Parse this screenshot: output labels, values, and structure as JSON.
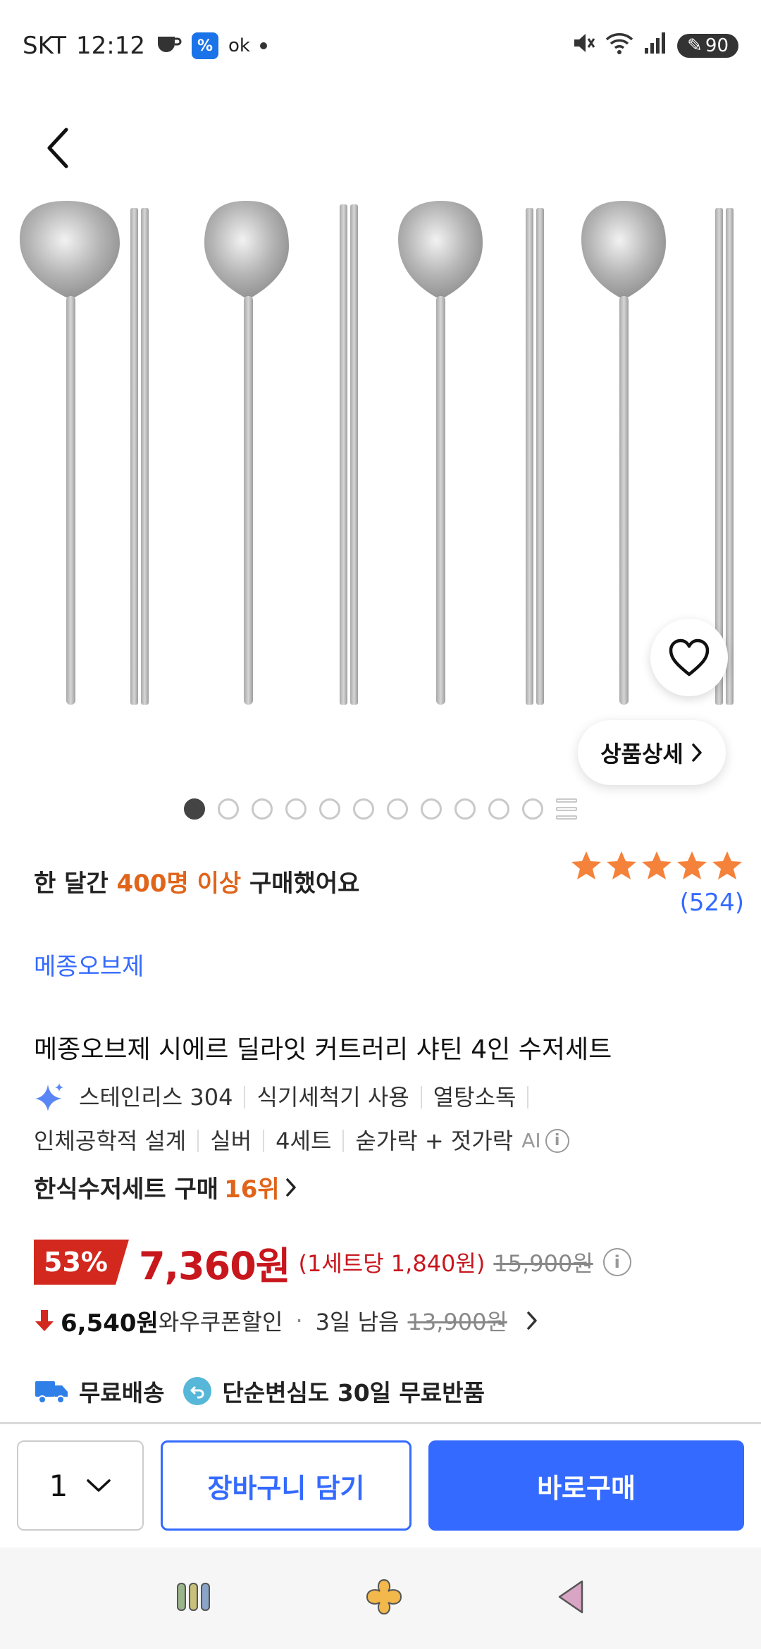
{
  "status_bar": {
    "carrier": "SKT",
    "time": "12:12",
    "app_badge_1": "%",
    "app_badge_2": "ok",
    "battery": "90"
  },
  "product": {
    "detail_button": "상품상세",
    "image_count": 11,
    "active_image": 1
  },
  "purchase": {
    "prefix": "한 달간 ",
    "highlight": "400명 이상",
    "suffix": " 구매했어요",
    "rating": 5,
    "review_count": "(524)"
  },
  "brand": "메종오브제",
  "title": "메종오브제 시에르 딜라잇 커트러리 샤틴 4인 수저세트",
  "attributes": {
    "line1": [
      "스테인리스 304",
      "식기세척기 사용",
      "열탕소독"
    ],
    "line2": [
      "인체공학적 설계",
      "실버",
      "4세트",
      "숟가락 + 젓가락"
    ],
    "ai_label": "AI"
  },
  "rank": {
    "text": "한식수저세트 구매 ",
    "number": "16위"
  },
  "price": {
    "discount": "53%",
    "sale_price": "7,360원",
    "unit_price": "(1세트당 1,840원)",
    "original_price": "15,900원"
  },
  "coupon": {
    "price": "6,540원",
    "label": " 와우쿠폰할인",
    "dot": "·",
    "remaining": "3일 남음",
    "strike_price": "13,900원"
  },
  "delivery": {
    "free_shipping": "무료배송",
    "free_return": "단순변심도 30일 무료반품"
  },
  "bottom": {
    "quantity": "1",
    "cart_label": "장바구니 담기",
    "buy_label": "바로구매"
  },
  "colors": {
    "accent_blue": "#346aff",
    "price_red": "#c8161d",
    "highlight_orange": "#e0641a",
    "star_orange": "#f5823b"
  }
}
